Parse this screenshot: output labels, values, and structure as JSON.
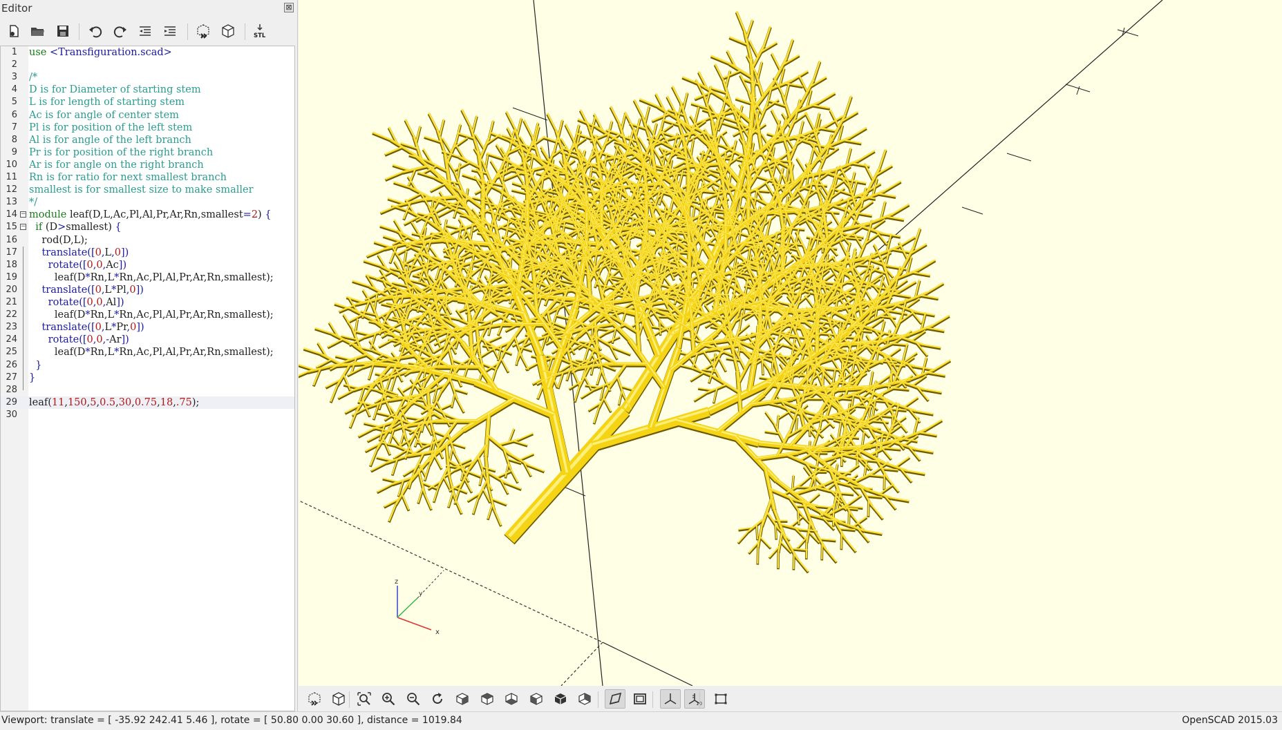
{
  "editor": {
    "title": "Editor",
    "close_glyph": "⊠",
    "toolbar": [
      {
        "name": "new-file-icon",
        "tooltip": "New"
      },
      {
        "name": "open-file-icon",
        "tooltip": "Open"
      },
      {
        "name": "save-icon",
        "tooltip": "Save"
      },
      {
        "name": "undo-icon",
        "tooltip": "Undo"
      },
      {
        "name": "redo-icon",
        "tooltip": "Redo"
      },
      {
        "name": "unindent-icon",
        "tooltip": "Unindent"
      },
      {
        "name": "indent-icon",
        "tooltip": "Indent"
      },
      {
        "name": "preview-icon",
        "tooltip": "Preview"
      },
      {
        "name": "render-icon",
        "tooltip": "Render"
      },
      {
        "name": "export-stl-icon",
        "tooltip": "Export as STL",
        "label": "STL"
      }
    ],
    "code_lines": [
      {
        "n": "1",
        "tokens": [
          [
            "kw",
            "use "
          ],
          [
            "call",
            "<Transfiguration.scad>"
          ]
        ]
      },
      {
        "n": "2",
        "tokens": []
      },
      {
        "n": "3",
        "tokens": [
          [
            "comment",
            "/*"
          ]
        ]
      },
      {
        "n": "4",
        "tokens": [
          [
            "comment",
            "D is for Diameter of starting stem"
          ]
        ]
      },
      {
        "n": "5",
        "tokens": [
          [
            "comment",
            "L is for length of starting stem"
          ]
        ]
      },
      {
        "n": "6",
        "tokens": [
          [
            "comment",
            "Ac is for angle of center stem"
          ]
        ]
      },
      {
        "n": "7",
        "tokens": [
          [
            "comment",
            "Pl is for position of the left stem"
          ]
        ]
      },
      {
        "n": "8",
        "tokens": [
          [
            "comment",
            "Al is for angle of the left branch"
          ]
        ]
      },
      {
        "n": "9",
        "tokens": [
          [
            "comment",
            "Pr is for position of the right branch"
          ]
        ]
      },
      {
        "n": "10",
        "tokens": [
          [
            "comment",
            "Ar is for angle on the right branch"
          ]
        ]
      },
      {
        "n": "11",
        "tokens": [
          [
            "comment",
            "Rn is for ratio for next smallest branch"
          ]
        ]
      },
      {
        "n": "12",
        "tokens": [
          [
            "comment",
            "smallest is for smallest size to make smaller"
          ]
        ]
      },
      {
        "n": "13",
        "tokens": [
          [
            "comment",
            "*/"
          ]
        ]
      },
      {
        "n": "14",
        "fold": "open",
        "tokens": [
          [
            "kw",
            "module "
          ],
          [
            "plain",
            "leaf(D,L,Ac,Pl,Al,Pr,Ar,Rn,smallest"
          ],
          [
            "call",
            "="
          ],
          [
            "num",
            "2"
          ],
          [
            "plain",
            ") "
          ],
          [
            "call",
            "{"
          ]
        ]
      },
      {
        "n": "15",
        "fold": "open",
        "tokens": [
          [
            "plain",
            "  "
          ],
          [
            "kw",
            "if "
          ],
          [
            "plain",
            "(D"
          ],
          [
            "call",
            ">"
          ],
          [
            "plain",
            "smallest) "
          ],
          [
            "call",
            "{"
          ]
        ]
      },
      {
        "n": "16",
        "tokens": [
          [
            "plain",
            "    rod(D,L);"
          ]
        ]
      },
      {
        "n": "17",
        "tokens": [
          [
            "plain",
            "    "
          ],
          [
            "call",
            "translate(["
          ],
          [
            "num",
            "0"
          ],
          [
            "call",
            ","
          ],
          [
            "plain",
            "L"
          ],
          [
            "call",
            ","
          ],
          [
            "num",
            "0"
          ],
          [
            "call",
            "])"
          ]
        ]
      },
      {
        "n": "18",
        "tokens": [
          [
            "plain",
            "      "
          ],
          [
            "call",
            "rotate(["
          ],
          [
            "num",
            "0"
          ],
          [
            "call",
            ","
          ],
          [
            "num",
            "0"
          ],
          [
            "call",
            ","
          ],
          [
            "plain",
            "Ac"
          ],
          [
            "call",
            "])"
          ]
        ]
      },
      {
        "n": "19",
        "tokens": [
          [
            "plain",
            "        leaf(D"
          ],
          [
            "call",
            "*"
          ],
          [
            "plain",
            "Rn,L"
          ],
          [
            "call",
            "*"
          ],
          [
            "plain",
            "Rn,Ac,Pl,Al,Pr,Ar,Rn,smallest);"
          ]
        ]
      },
      {
        "n": "20",
        "tokens": [
          [
            "plain",
            "    "
          ],
          [
            "call",
            "translate(["
          ],
          [
            "num",
            "0"
          ],
          [
            "call",
            ","
          ],
          [
            "plain",
            "L"
          ],
          [
            "call",
            "*"
          ],
          [
            "plain",
            "Pl"
          ],
          [
            "call",
            ","
          ],
          [
            "num",
            "0"
          ],
          [
            "call",
            "])"
          ]
        ]
      },
      {
        "n": "21",
        "tokens": [
          [
            "plain",
            "      "
          ],
          [
            "call",
            "rotate(["
          ],
          [
            "num",
            "0"
          ],
          [
            "call",
            ","
          ],
          [
            "num",
            "0"
          ],
          [
            "call",
            ","
          ],
          [
            "plain",
            "Al"
          ],
          [
            "call",
            "])"
          ]
        ]
      },
      {
        "n": "22",
        "tokens": [
          [
            "plain",
            "        leaf(D"
          ],
          [
            "call",
            "*"
          ],
          [
            "plain",
            "Rn,L"
          ],
          [
            "call",
            "*"
          ],
          [
            "plain",
            "Rn,Ac,Pl,Al,Pr,Ar,Rn,smallest);"
          ]
        ]
      },
      {
        "n": "23",
        "tokens": [
          [
            "plain",
            "    "
          ],
          [
            "call",
            "translate(["
          ],
          [
            "num",
            "0"
          ],
          [
            "call",
            ","
          ],
          [
            "plain",
            "L"
          ],
          [
            "call",
            "*"
          ],
          [
            "plain",
            "Pr"
          ],
          [
            "call",
            ","
          ],
          [
            "num",
            "0"
          ],
          [
            "call",
            "])"
          ]
        ]
      },
      {
        "n": "24",
        "tokens": [
          [
            "plain",
            "      "
          ],
          [
            "call",
            "rotate(["
          ],
          [
            "num",
            "0"
          ],
          [
            "call",
            ","
          ],
          [
            "num",
            "0"
          ],
          [
            "call",
            ",-"
          ],
          [
            "plain",
            "Ar"
          ],
          [
            "call",
            "])"
          ]
        ]
      },
      {
        "n": "25",
        "tokens": [
          [
            "plain",
            "        leaf(D"
          ],
          [
            "call",
            "*"
          ],
          [
            "plain",
            "Rn,L"
          ],
          [
            "call",
            "*"
          ],
          [
            "plain",
            "Rn,Ac,Pl,Al,Pr,Ar,Rn,smallest);"
          ]
        ]
      },
      {
        "n": "26",
        "tokens": [
          [
            "plain",
            "  "
          ],
          [
            "call",
            "}"
          ]
        ]
      },
      {
        "n": "27",
        "tokens": [
          [
            "call",
            "}"
          ]
        ]
      },
      {
        "n": "28",
        "tokens": []
      },
      {
        "n": "29",
        "current": true,
        "tokens": [
          [
            "plain",
            "leaf("
          ],
          [
            "num",
            "11"
          ],
          [
            "plain",
            ","
          ],
          [
            "num",
            "150"
          ],
          [
            "plain",
            ","
          ],
          [
            "num",
            "5"
          ],
          [
            "plain",
            ","
          ],
          [
            "num",
            "0.5"
          ],
          [
            "plain",
            ","
          ],
          [
            "num",
            "30"
          ],
          [
            "plain",
            ","
          ],
          [
            "num",
            "0.75"
          ],
          [
            "plain",
            ","
          ],
          [
            "num",
            "18"
          ],
          [
            "plain",
            ","
          ],
          [
            "num",
            ".75"
          ],
          [
            "plain",
            ");"
          ]
        ]
      },
      {
        "n": "30",
        "tokens": []
      }
    ]
  },
  "viewport": {
    "background": "#ffffe5",
    "model_color": "#f5d315",
    "axis_labels": {
      "x": "x",
      "y": "y",
      "z": "z"
    }
  },
  "view_toolbar": [
    {
      "name": "preview-icon",
      "active": false
    },
    {
      "name": "render-icon",
      "active": false
    },
    {
      "name": "view-all-icon",
      "active": false
    },
    {
      "name": "zoom-in-icon",
      "active": false
    },
    {
      "name": "zoom-out-icon",
      "active": false
    },
    {
      "name": "reset-view-icon",
      "active": false
    },
    {
      "name": "view-right-icon",
      "active": false
    },
    {
      "name": "view-top-icon",
      "active": false
    },
    {
      "name": "view-bottom-icon",
      "active": false
    },
    {
      "name": "view-left-icon",
      "active": false
    },
    {
      "name": "view-front-icon",
      "active": false
    },
    {
      "name": "view-back-icon",
      "active": false
    },
    {
      "name": "perspective-icon",
      "active": true
    },
    {
      "name": "orthogonal-icon",
      "active": false
    },
    {
      "name": "show-axes-icon",
      "active": true
    },
    {
      "name": "show-scale-markers-icon",
      "active": true
    },
    {
      "name": "show-edges-icon",
      "active": false
    }
  ],
  "status": {
    "viewport": "Viewport: translate = [ -35.92 242.41 5.46 ], rotate = [ 50.80 0.00 30.60 ], distance = 1019.84",
    "version": "OpenSCAD 2015.03"
  }
}
